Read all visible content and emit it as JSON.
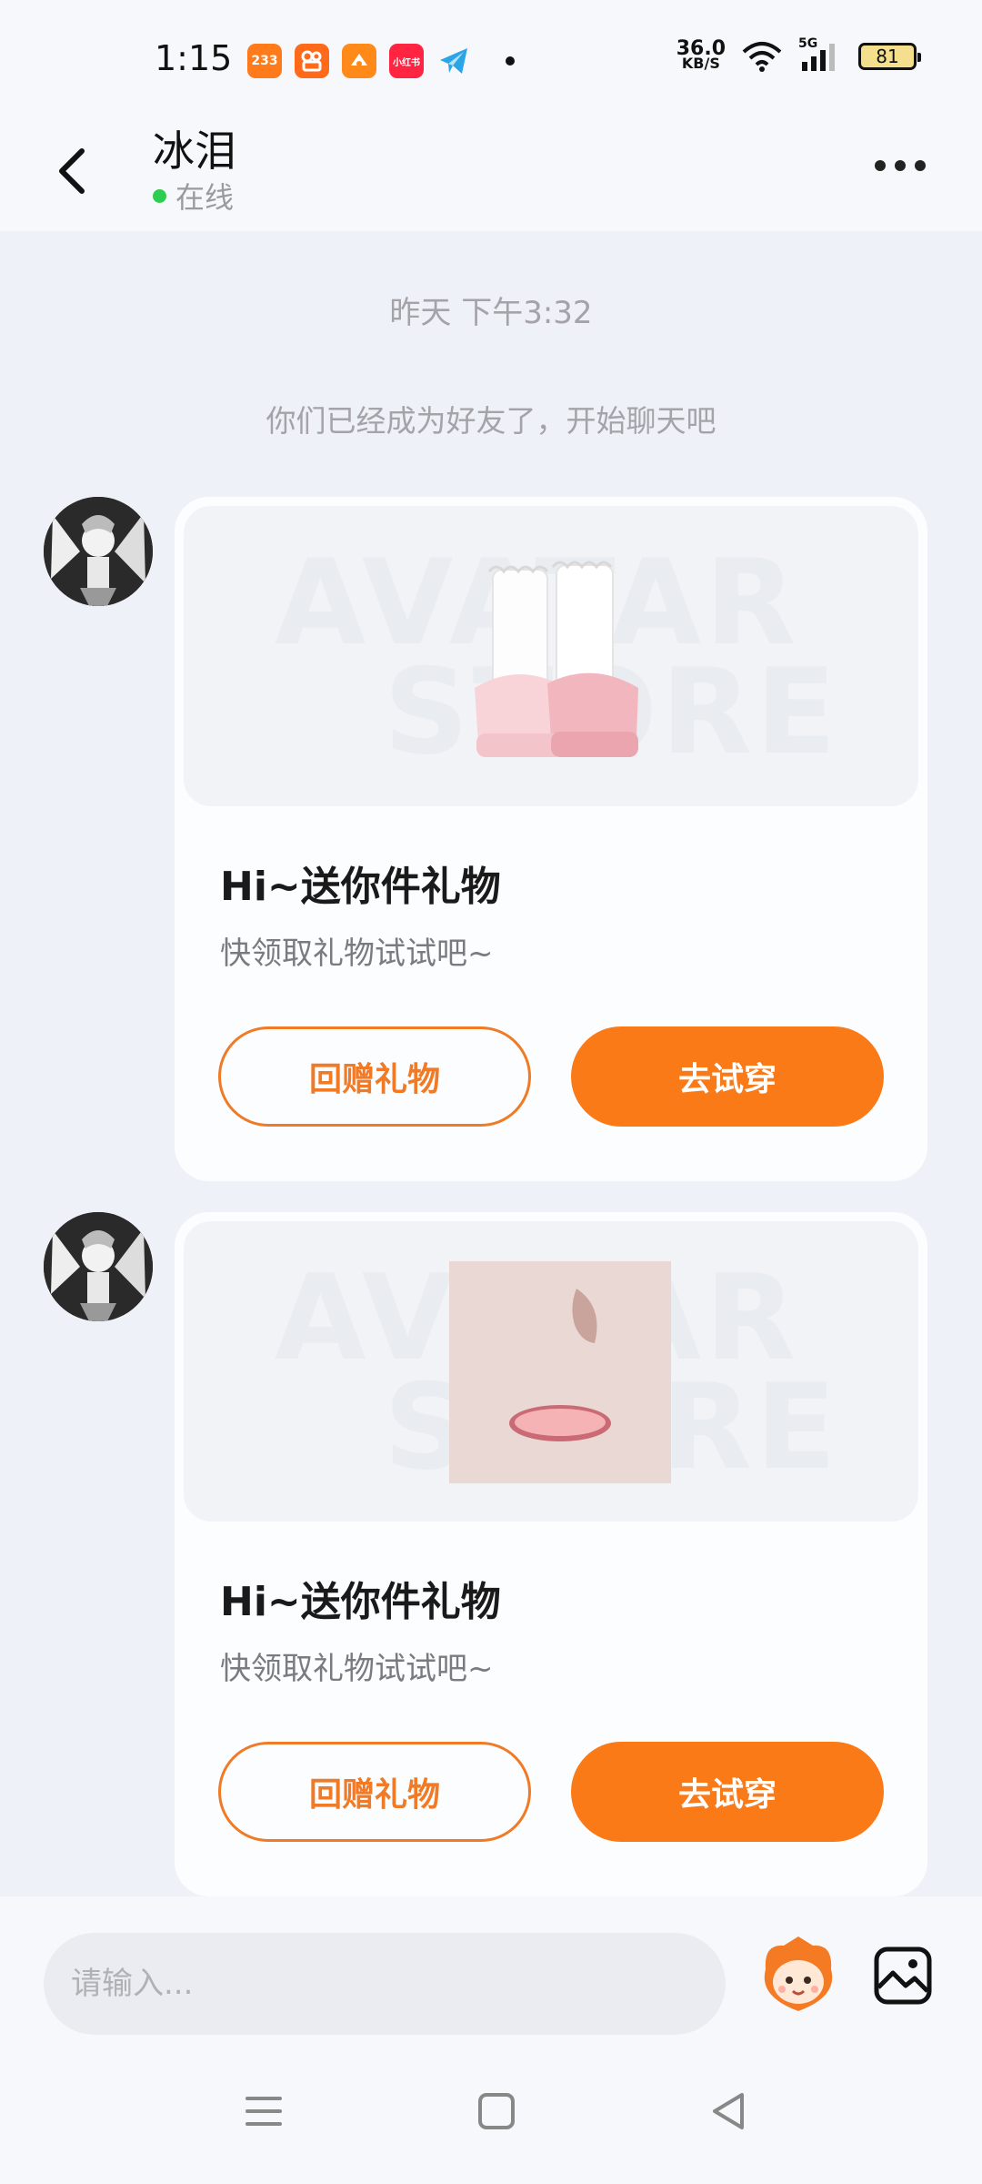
{
  "status_bar": {
    "time": "1:15",
    "app_icons": [
      {
        "label": "233",
        "color": "#ff7a1a",
        "name": "app-233-icon"
      },
      {
        "label": "",
        "color": "#ff6a1a",
        "name": "app-kuaishou-icon"
      },
      {
        "label": "",
        "color": "#ff8a1a",
        "name": "app-game-icon"
      },
      {
        "label": "小红书",
        "color": "#ff2442",
        "name": "app-xiaohongshu-icon"
      },
      {
        "label": "",
        "color": "#2aa6e8",
        "name": "app-telegram-icon"
      }
    ],
    "net_speed_value": "36.0",
    "net_speed_unit": "KB/S",
    "network": "5G",
    "battery": "81"
  },
  "header": {
    "contact_name": "冰泪",
    "status_text": "在线"
  },
  "chat": {
    "timestamp": "昨天 下午3:32",
    "system_message": "你们已经成为好友了，开始聊天吧",
    "watermark_line1": "AVATAR",
    "watermark_line2": "STORE",
    "messages": [
      {
        "title": "Hi~送你件礼物",
        "subtitle": "快领取礼物试试吧~",
        "gift_button": "回赠礼物",
        "try_button": "去试穿",
        "item": "shoes"
      },
      {
        "title": "Hi~送你件礼物",
        "subtitle": "快领取礼物试试吧~",
        "gift_button": "回赠礼物",
        "try_button": "去试穿",
        "item": "face"
      }
    ]
  },
  "input": {
    "placeholder": "请输入..."
  },
  "colors": {
    "accent": "#fa7a18",
    "online": "#2fcc52"
  }
}
